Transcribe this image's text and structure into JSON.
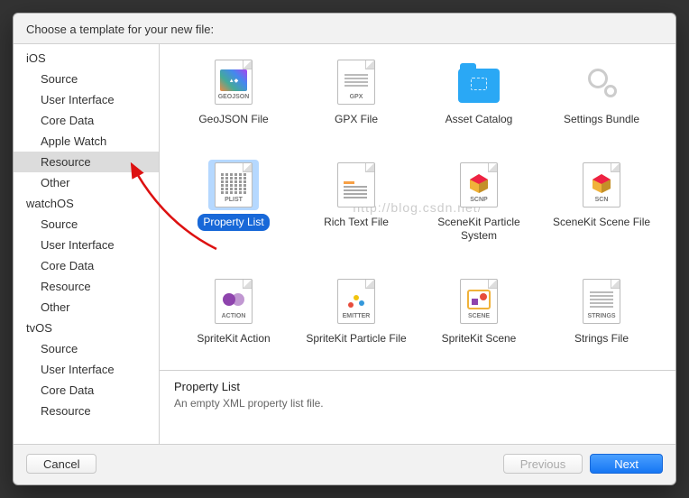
{
  "header": {
    "title": "Choose a template for your new file:"
  },
  "sidebar": {
    "groups": [
      {
        "label": "iOS",
        "items": [
          "Source",
          "User Interface",
          "Core Data",
          "Apple Watch",
          "Resource",
          "Other"
        ],
        "selected_index": 4
      },
      {
        "label": "watchOS",
        "items": [
          "Source",
          "User Interface",
          "Core Data",
          "Resource",
          "Other"
        ]
      },
      {
        "label": "tvOS",
        "items": [
          "Source",
          "User Interface",
          "Core Data",
          "Resource"
        ]
      }
    ]
  },
  "templates": [
    {
      "label": "GeoJSON File",
      "tag": "GEOJSON",
      "kind": "geojson"
    },
    {
      "label": "GPX File",
      "tag": "GPX",
      "kind": "gpx"
    },
    {
      "label": "Asset Catalog",
      "tag": "",
      "kind": "folder"
    },
    {
      "label": "Settings Bundle",
      "tag": "",
      "kind": "gears"
    },
    {
      "label": "Property List",
      "tag": "PLIST",
      "kind": "plist",
      "selected": true
    },
    {
      "label": "Rich Text File",
      "tag": "",
      "kind": "rtf"
    },
    {
      "label": "SceneKit Particle System",
      "tag": "SCNP",
      "kind": "scnp"
    },
    {
      "label": "SceneKit Scene File",
      "tag": "SCN",
      "kind": "scnp"
    },
    {
      "label": "SpriteKit Action",
      "tag": "ACTION",
      "kind": "action"
    },
    {
      "label": "SpriteKit Particle File",
      "tag": "EMITTER",
      "kind": "emitter"
    },
    {
      "label": "SpriteKit Scene",
      "tag": "SCENE",
      "kind": "scene"
    },
    {
      "label": "Strings File",
      "tag": "STRINGS",
      "kind": "strings"
    }
  ],
  "description": {
    "title": "Property List",
    "text": "An empty XML property list file."
  },
  "footer": {
    "cancel": "Cancel",
    "previous": "Previous",
    "next": "Next",
    "previous_enabled": false
  },
  "watermark": "http://blog.csdn.net/"
}
